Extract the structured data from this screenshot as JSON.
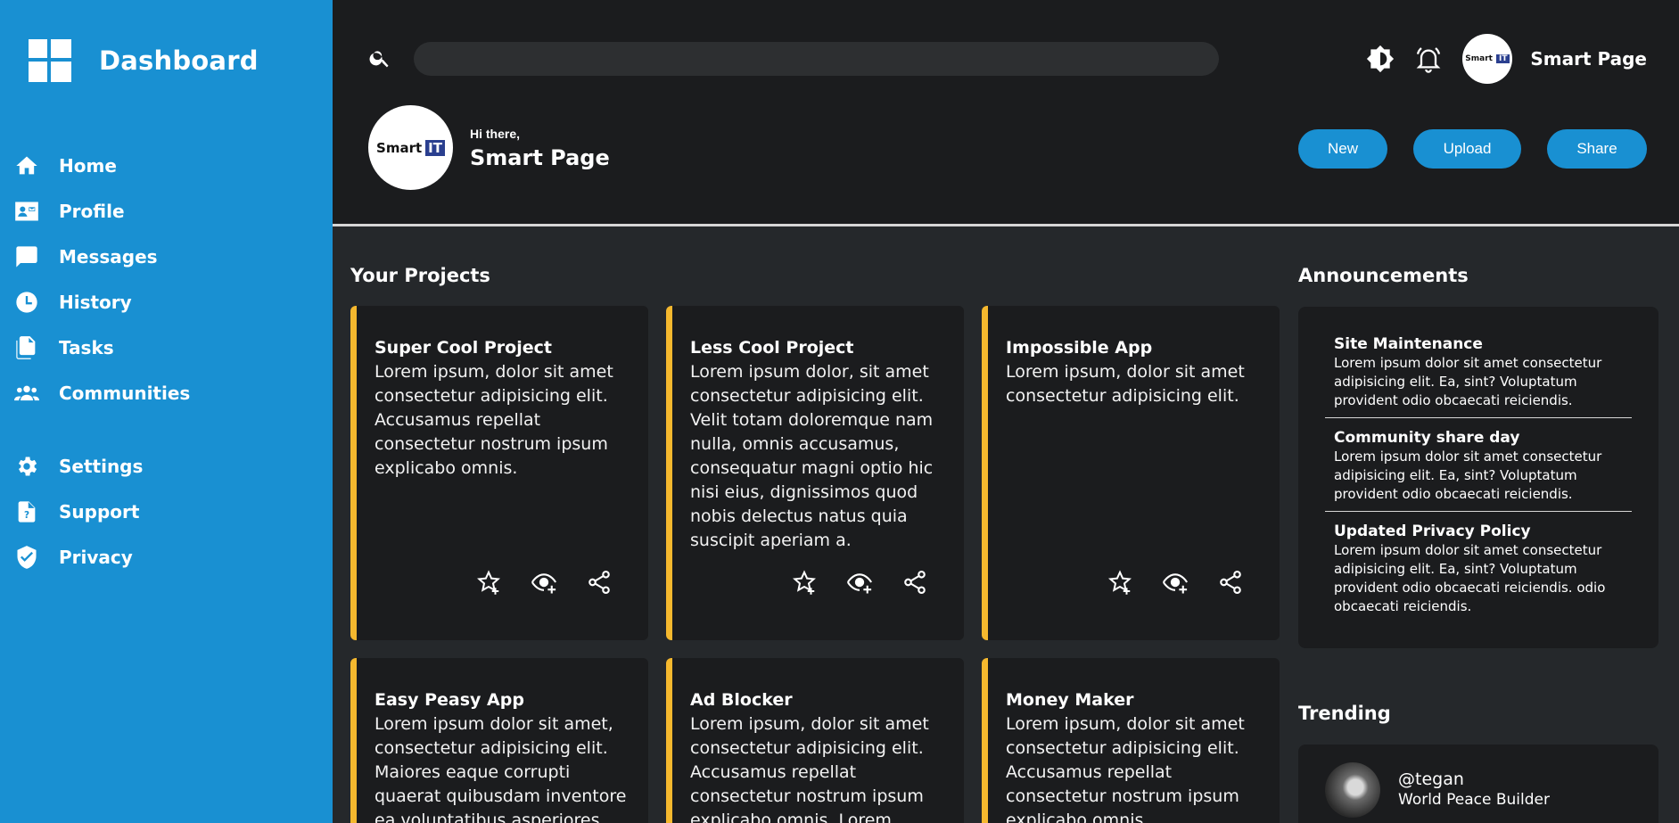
{
  "sidebar": {
    "title": "Dashboard",
    "items": [
      {
        "label": "Home",
        "icon": "home-icon"
      },
      {
        "label": "Profile",
        "icon": "profile-card-icon"
      },
      {
        "label": "Messages",
        "icon": "message-icon"
      },
      {
        "label": "History",
        "icon": "clock-icon"
      },
      {
        "label": "Tasks",
        "icon": "documents-icon"
      },
      {
        "label": "Communities",
        "icon": "group-icon"
      },
      {
        "label": "Settings",
        "icon": "gear-icon"
      },
      {
        "label": "Support",
        "icon": "help-document-icon"
      },
      {
        "label": "Privacy",
        "icon": "shield-check-icon"
      }
    ]
  },
  "header": {
    "search_placeholder": "",
    "user_name": "Smart Page",
    "logo_text": "Smart",
    "logo_badge": "IT",
    "greeting": "Hi there,",
    "greeting_name": "Smart Page",
    "buttons": {
      "new": "New",
      "upload": "Upload",
      "share": "Share"
    }
  },
  "projects": {
    "title": "Your Projects",
    "items": [
      {
        "title": "Super Cool Project",
        "desc": "Lorem ipsum, dolor sit amet consectetur adipisicing elit. Accusamus repellat consectetur nostrum ipsum explicabo omnis."
      },
      {
        "title": "Less Cool Project",
        "desc": "Lorem ipsum dolor, sit amet consectetur adipisicing elit. Velit totam doloremque nam nulla, omnis accusamus, consequatur magni optio hic nisi eius, dignissimos quod nobis delectus natus quia suscipit aperiam a."
      },
      {
        "title": "Impossible App",
        "desc": "Lorem ipsum, dolor sit amet consectetur adipisicing elit."
      },
      {
        "title": "Easy Peasy App",
        "desc": "Lorem ipsum dolor sit amet, consectetur adipisicing elit. Maiores eaque corrupti quaerat quibusdam inventore ea voluptatibus asperiores ducimus"
      },
      {
        "title": "Ad Blocker",
        "desc": "Lorem ipsum, dolor sit amet consectetur adipisicing elit. Accusamus repellat consectetur nostrum ipsum explicabo omnis. Lorem ipsum dolor sit amet"
      },
      {
        "title": "Money Maker",
        "desc": "Lorem ipsum, dolor sit amet consectetur adipisicing elit. Accusamus repellat consectetur nostrum ipsum explicabo omnis."
      }
    ]
  },
  "announcements": {
    "title": "Announcements",
    "items": [
      {
        "title": "Site Maintenance",
        "text": "Lorem ipsum dolor sit amet consectetur adipisicing elit. Ea, sint? Voluptatum provident odio obcaecati reiciendis."
      },
      {
        "title": "Community share day",
        "text": "Lorem ipsum dolor sit amet consectetur adipisicing elit. Ea, sint? Voluptatum provident odio obcaecati reiciendis."
      },
      {
        "title": "Updated Privacy Policy",
        "text": "Lorem ipsum dolor sit amet consectetur adipisicing elit. Ea, sint? Voluptatum provident odio obcaecati reiciendis. odio obcaecati reiciendis."
      }
    ]
  },
  "trending": {
    "title": "Trending",
    "items": [
      {
        "handle": "@tegan",
        "role": "World Peace Builder"
      }
    ]
  },
  "colors": {
    "sidebar": "#1990d2",
    "accent": "#f5b82e",
    "card": "#1b1c1e",
    "background": "#25282b"
  }
}
